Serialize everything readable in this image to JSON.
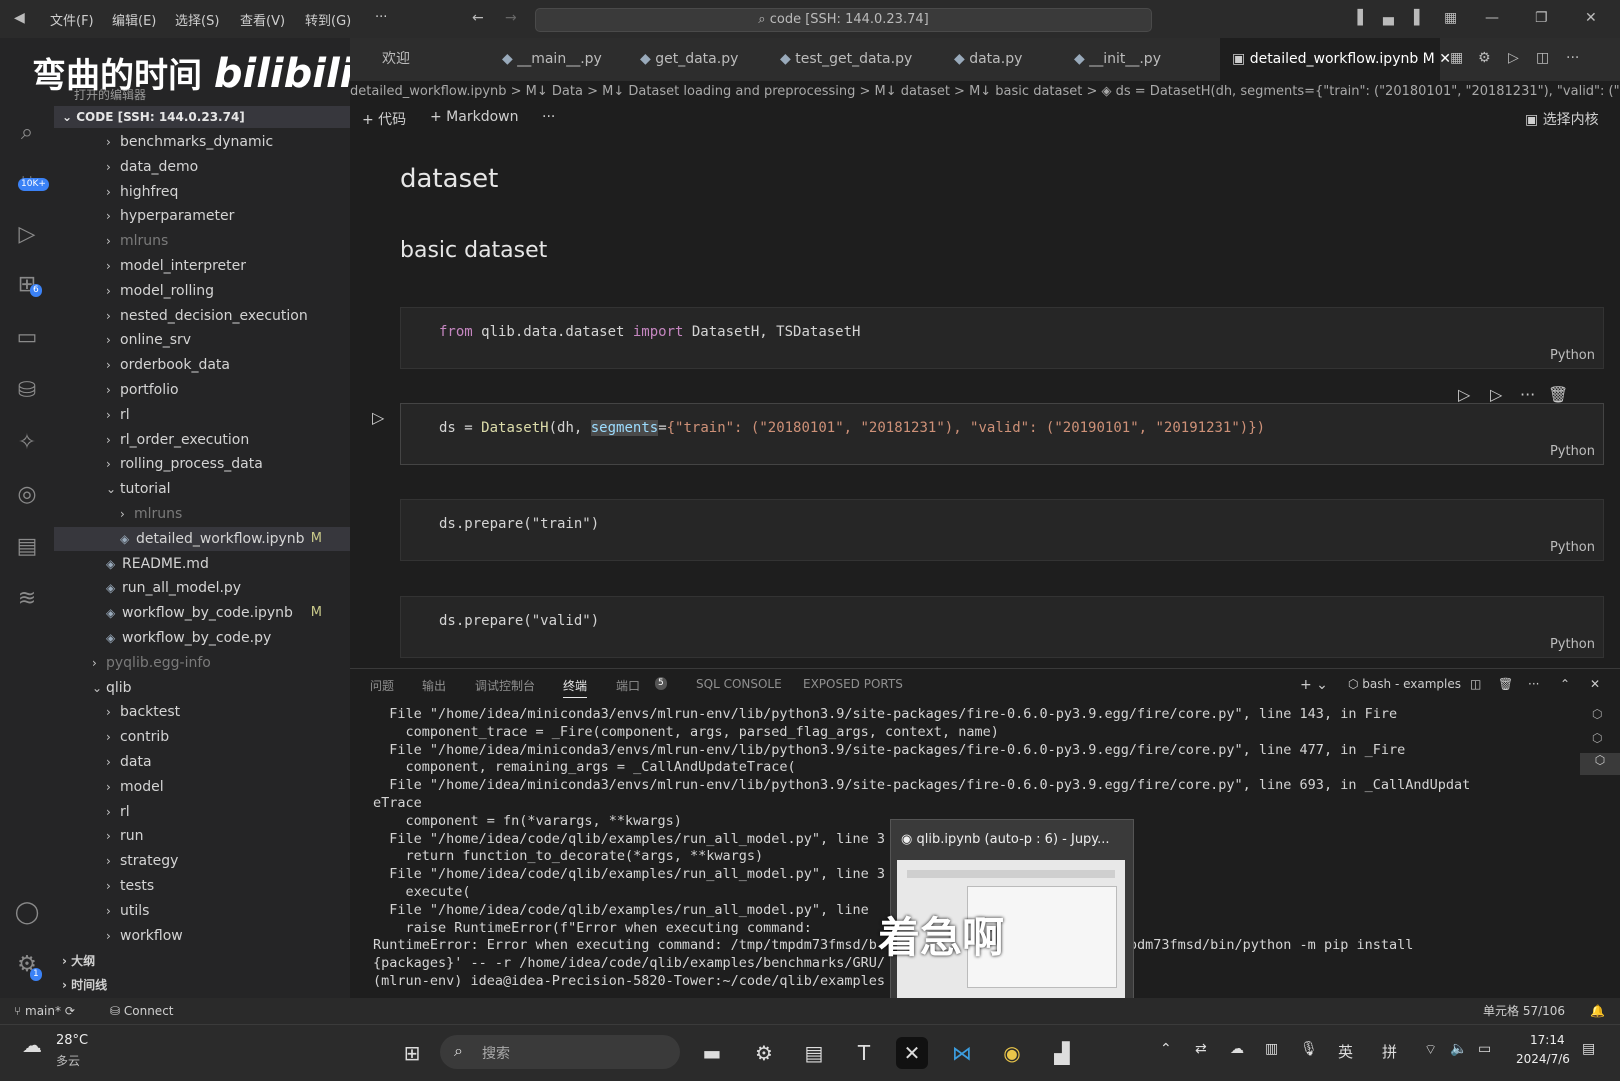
{
  "titlebar": {
    "menus": [
      "文件(F)",
      "编辑(E)",
      "选择(S)",
      "查看(V)",
      "转到(G)",
      "···"
    ],
    "command_center": "code [SSH: 144.0.23.74]"
  },
  "watermark": {
    "text": "弯曲的时间",
    "logo": "bilibili"
  },
  "activity": {
    "source_control_badge": "10K+",
    "extensions_badge": "6",
    "settings_badge": "1"
  },
  "sidebar": {
    "open_editors_label": "打开的编辑器",
    "root_label": "CODE [SSH: 144.0.23.74]",
    "items": [
      {
        "label": "benchmarks_dynamic",
        "type": "folder"
      },
      {
        "label": "data_demo",
        "type": "folder"
      },
      {
        "label": "highfreq",
        "type": "folder"
      },
      {
        "label": "hyperparameter",
        "type": "folder"
      },
      {
        "label": "mlruns",
        "type": "folder",
        "dim": true
      },
      {
        "label": "model_interpreter",
        "type": "folder"
      },
      {
        "label": "model_rolling",
        "type": "folder"
      },
      {
        "label": "nested_decision_execution",
        "type": "folder"
      },
      {
        "label": "online_srv",
        "type": "folder"
      },
      {
        "label": "orderbook_data",
        "type": "folder"
      },
      {
        "label": "portfolio",
        "type": "folder"
      },
      {
        "label": "rl",
        "type": "folder"
      },
      {
        "label": "rl_order_execution",
        "type": "folder"
      },
      {
        "label": "rolling_process_data",
        "type": "folder"
      },
      {
        "label": "tutorial",
        "type": "folder-open"
      },
      {
        "label": "mlruns",
        "type": "folder",
        "dim": true
      },
      {
        "label": "detailed_workflow.ipynb",
        "type": "file",
        "mod": "M",
        "selected": true
      },
      {
        "label": "README.md",
        "type": "file"
      },
      {
        "label": "run_all_model.py",
        "type": "file"
      },
      {
        "label": "workflow_by_code.ipynb",
        "type": "file",
        "mod": "M"
      },
      {
        "label": "workflow_by_code.py",
        "type": "file"
      },
      {
        "label": "pyqlib.egg-info",
        "type": "folder",
        "dim": true
      },
      {
        "label": "qlib",
        "type": "folder-open"
      },
      {
        "label": "backtest",
        "type": "folder"
      },
      {
        "label": "contrib",
        "type": "folder"
      },
      {
        "label": "data",
        "type": "folder"
      },
      {
        "label": "model",
        "type": "folder"
      },
      {
        "label": "rl",
        "type": "folder"
      },
      {
        "label": "run",
        "type": "folder"
      },
      {
        "label": "strategy",
        "type": "folder"
      },
      {
        "label": "tests",
        "type": "folder"
      },
      {
        "label": "utils",
        "type": "folder"
      },
      {
        "label": "workflow",
        "type": "folder"
      }
    ],
    "outline_label": "大纲",
    "timeline_label": "时间线"
  },
  "tabs": [
    {
      "label": "欢迎"
    },
    {
      "label": "__main__.py"
    },
    {
      "label": "get_data.py"
    },
    {
      "label": "test_get_data.py"
    },
    {
      "label": "data.py"
    },
    {
      "label": "__init__.py"
    },
    {
      "label": "detailed_workflow.ipynb M",
      "active": true
    }
  ],
  "breadcrumb": "detailed_workflow.ipynb  >  M↓ Data  >  M↓ Dataset loading and preprocessing  >  M↓ dataset  >  M↓ basic dataset  >  ◈ ds = DatasetH(dh, segments={\"train\": (\"20180101\", \"20181231\"), \"valid\": (\"2019010",
  "notebook_toolbar": {
    "add_code": "+ 代码",
    "add_markdown": "+ Markdown",
    "more": "···",
    "kernel": "选择内核"
  },
  "notebook": {
    "h1": "dataset",
    "h2": "basic dataset",
    "cell_lang": "Python",
    "cell1": {
      "kw1": "from",
      "mod": " qlib.data.dataset ",
      "kw2": "import",
      "rest": " DatasetH, TSDatasetH"
    },
    "cell2": {
      "pre": "ds = ",
      "fn": "DatasetH",
      "mid": "(dh, ",
      "kwarg": "segments",
      "eq": "=",
      "rest": "{\"train\": (\"20180101\", \"20181231\"), \"valid\": (\"20190101\", \"20191231\")})"
    },
    "cell3": "ds.prepare(\"train\")",
    "cell4": "ds.prepare(\"valid\")"
  },
  "panel": {
    "tabs": [
      "问题",
      "输出",
      "调试控制台",
      "终端",
      "端口",
      "SQL CONSOLE",
      "EXPOSED PORTS"
    ],
    "ports_badge": "5",
    "shell": "bash - examples",
    "terminal_lines": [
      "  File \"/home/idea/miniconda3/envs/mlrun-env/lib/python3.9/site-packages/fire-0.6.0-py3.9.egg/fire/core.py\", line 143, in Fire",
      "    component_trace = _Fire(component, args, parsed_flag_args, context, name)",
      "  File \"/home/idea/miniconda3/envs/mlrun-env/lib/python3.9/site-packages/fire-0.6.0-py3.9.egg/fire/core.py\", line 477, in _Fire",
      "    component, remaining_args = _CallAndUpdateTrace(",
      "  File \"/home/idea/miniconda3/envs/mlrun-env/lib/python3.9/site-packages/fire-0.6.0-py3.9.egg/fire/core.py\", line 693, in _CallAndUpdat",
      "eTrace",
      "    component = fn(*varargs, **kwargs)",
      "  File \"/home/idea/code/qlib/examples/run_all_model.py\", line 3",
      "    return function_to_decorate(*args, **kwargs)",
      "  File \"/home/idea/code/qlib/examples/run_all_model.py\", line 3",
      "    execute(",
      "  File \"/home/idea/code/qlib/examples/run_all_model.py\", line",
      "    raise RuntimeError(f\"Error when executing command:",
      "RuntimeError: Error when executing command: /tmp/tmpdm73fmsd/b                        /tmp/tmpdm73fmsd/bin/python -m pip install",
      "{packages}' -- -r /home/idea/code/qlib/examples/benchmarks/GRU/",
      "(mlrun-env) idea@idea-Precision-5820-Tower:~/code/qlib/examples"
    ]
  },
  "popup": {
    "title": "qlib.ipynb (auto-p : 6) - Jupy..."
  },
  "overlay_text": "着急啊",
  "statusbar": {
    "branch": "main*",
    "connect": "Connect",
    "cell": "单元格 57/106"
  },
  "taskbar": {
    "weather_temp": "28°C",
    "weather_desc": "多云",
    "search_placeholder": "搜索",
    "ime1": "英",
    "ime2": "拼",
    "time": "17:14",
    "date": "2024/7/6"
  }
}
